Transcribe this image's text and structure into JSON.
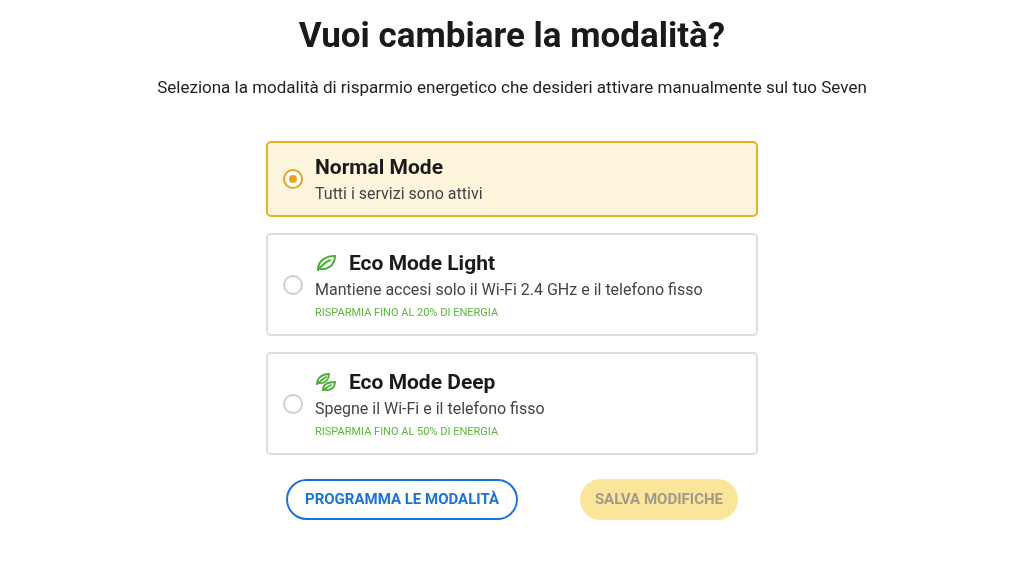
{
  "title": "Vuoi cambiare la modalità?",
  "subtitle": "Seleziona la modalità di risparmio energetico che desideri attivare manualmente sul tuo Seven",
  "options": [
    {
      "kind": "normal",
      "title": "Normal Mode",
      "description": "Tutti i servizi sono attivi",
      "selected": true
    },
    {
      "kind": "leaf",
      "title": "Eco Mode Light",
      "description": "Mantiene accesi solo il Wi-Fi 2.4 GHz e il telefono fisso",
      "saving": "RISPARMIA FINO AL 20% DI ENERGIA",
      "selected": false
    },
    {
      "kind": "leaves",
      "title": "Eco Mode Deep",
      "description": "Spegne il Wi-Fi e il telefono fisso",
      "saving": "RISPARMIA FINO AL 50% DI ENERGIA",
      "selected": false
    }
  ],
  "buttons": {
    "schedule": {
      "label": "PROGRAMMA LE MODALITÀ"
    },
    "save": {
      "label": "SALVA MODIFICHE",
      "disabled": true
    }
  }
}
